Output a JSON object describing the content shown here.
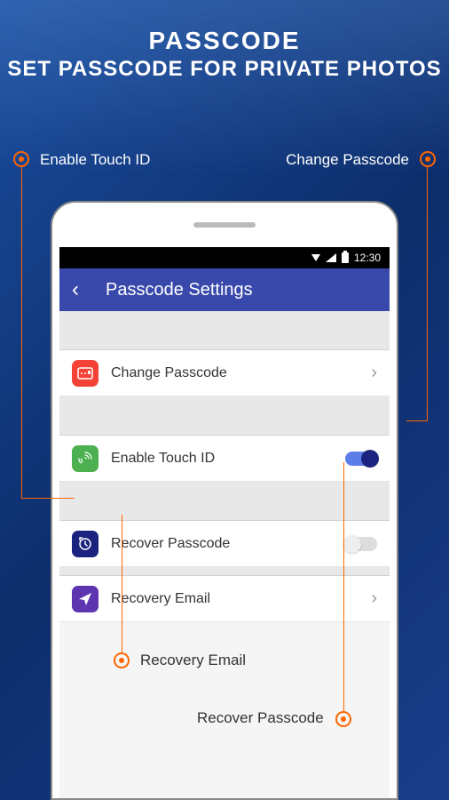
{
  "header": {
    "title": "PASSCODE",
    "subtitle": "SET PASSCODE FOR PRIVATE PHOTOS"
  },
  "callouts": {
    "topLeft": "Enable Touch ID",
    "topRight": "Change Passcode",
    "bottomLeft": "Recovery Email",
    "bottomRight": "Recover Passcode"
  },
  "statusBar": {
    "time": "12:30"
  },
  "appHeader": {
    "title": "Passcode Settings"
  },
  "settings": {
    "changePasscode": {
      "label": "Change Passcode"
    },
    "enableTouchId": {
      "label": "Enable Touch ID",
      "enabled": true
    },
    "recoverPasscode": {
      "label": "Recover Passcode",
      "enabled": false
    },
    "recoveryEmail": {
      "label": "Recovery Email"
    }
  }
}
